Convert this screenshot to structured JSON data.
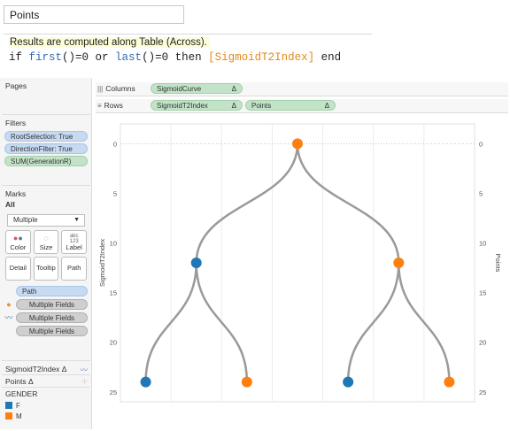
{
  "calc": {
    "name": "Points",
    "hint": "Results are computed along Table (Across).",
    "code_if": "if ",
    "code_first": "first",
    "code_a": "()=0 or ",
    "code_last": "last",
    "code_b": "()=0 then ",
    "code_field": "[SigmoidT2Index]",
    "code_end": " end"
  },
  "cards": {
    "pages_title": "Pages",
    "filters_title": "Filters",
    "filters": [
      "RootSelection: True",
      "DirectionFilter: True",
      "SUM(GenerationR)"
    ],
    "marks_title": "Marks",
    "marks_all": "All",
    "mark_type": "Multiple",
    "mark_buttons": {
      "color": "Color",
      "size": "Size",
      "label": "Label",
      "detail": "Detail",
      "tooltip": "Tooltip",
      "path": "Path"
    },
    "label_icon_text": "abc\n123",
    "mark_fields": [
      "Path",
      "Multiple Fields",
      "Multiple Fields",
      "Multiple Fields"
    ],
    "sub_marks": [
      "SigmoidT2Index Δ",
      "Points Δ"
    ],
    "legend_title": "GENDER",
    "legend": [
      {
        "label": "F",
        "color": "#1f77b4"
      },
      {
        "label": "M",
        "color": "#ff7f0e"
      }
    ]
  },
  "shelves": {
    "columns_label": "Columns",
    "rows_label": "Rows",
    "columns_pills": [
      "SigmoidCurve"
    ],
    "rows_pills": [
      "SigmoidT2Index",
      "Points"
    ],
    "delta": "Δ"
  },
  "chart_data": {
    "type": "line",
    "left_axis_label": "SigmoidT2Index",
    "right_axis_label": "Points",
    "y_ticks": [
      0,
      5,
      10,
      15,
      20,
      25
    ],
    "y_range": [
      -2,
      26
    ],
    "x_range": [
      0,
      7
    ],
    "edges": [
      {
        "from": [
          3.5,
          0
        ],
        "to": [
          1.5,
          12
        ]
      },
      {
        "from": [
          3.5,
          0
        ],
        "to": [
          5.5,
          12
        ]
      },
      {
        "from": [
          1.5,
          12
        ],
        "to": [
          0.5,
          24
        ]
      },
      {
        "from": [
          1.5,
          12
        ],
        "to": [
          2.5,
          24
        ]
      },
      {
        "from": [
          5.5,
          12
        ],
        "to": [
          4.5,
          24
        ]
      },
      {
        "from": [
          5.5,
          12
        ],
        "to": [
          6.5,
          24
        ]
      }
    ],
    "points": [
      {
        "x": 3.5,
        "y": 0,
        "gender": "M"
      },
      {
        "x": 1.5,
        "y": 12,
        "gender": "F"
      },
      {
        "x": 5.5,
        "y": 12,
        "gender": "M"
      },
      {
        "x": 0.5,
        "y": 24,
        "gender": "F"
      },
      {
        "x": 2.5,
        "y": 24,
        "gender": "M"
      },
      {
        "x": 4.5,
        "y": 24,
        "gender": "F"
      },
      {
        "x": 6.5,
        "y": 24,
        "gender": "M"
      }
    ],
    "colors": {
      "F": "#1f77b4",
      "M": "#ff7f0e",
      "edge": "#9a9a9a",
      "grid": "#ebebeb"
    }
  }
}
